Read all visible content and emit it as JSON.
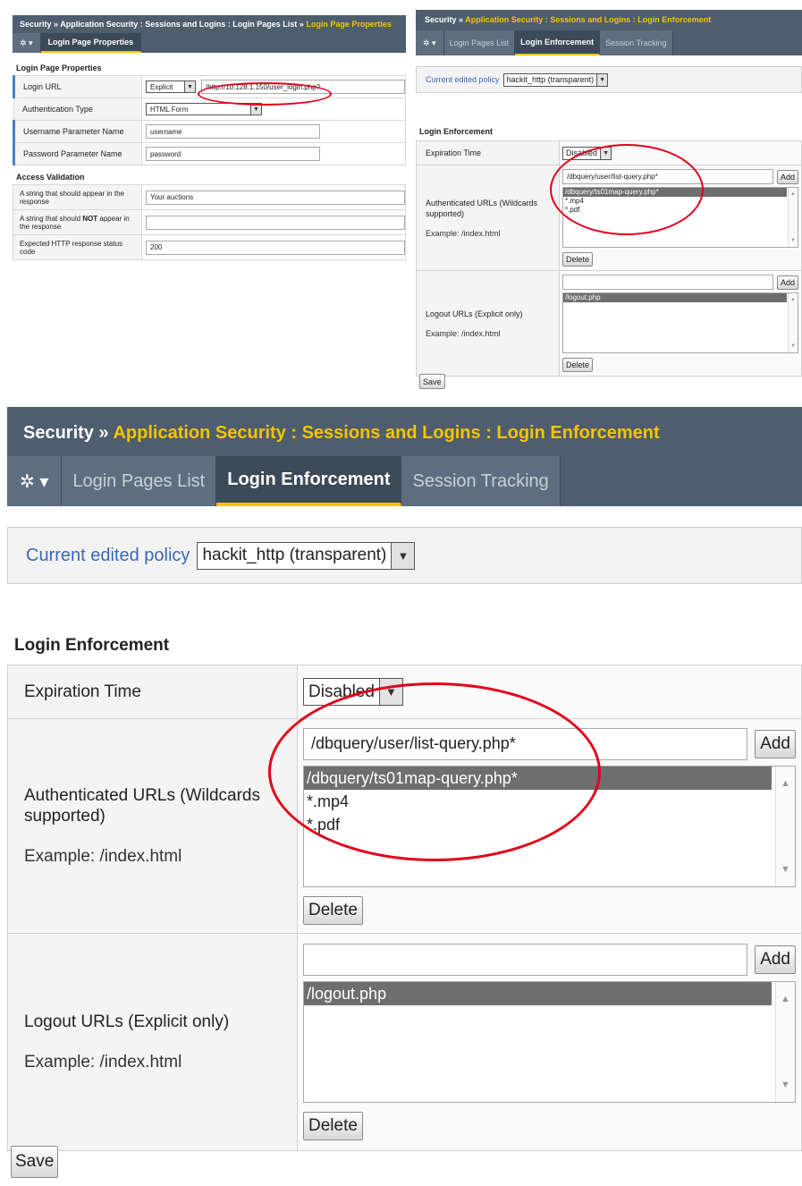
{
  "login_page_properties_panel": {
    "breadcrumb": {
      "root": "Security",
      "separator": "»",
      "path": "Application Security : Sessions and Logins : Login Pages List",
      "current": "Login Page Properties"
    },
    "tabs": {
      "gear_icon": "gear-icon",
      "active_tab": "Login Page Properties"
    },
    "section_title": "Login Page Properties",
    "fields": {
      "login_url_label": "Login URL",
      "login_url_type": "Explicit",
      "login_url_value": "/http://10.128.1.150/user_login.php?",
      "auth_type_label": "Authentication Type",
      "auth_type_value": "HTML Form",
      "username_param_label": "Username Parameter Name",
      "username_param_value": "username",
      "password_param_label": "Password Parameter Name",
      "password_param_value": "password"
    },
    "access_validation": {
      "title": "Access Validation",
      "should_appear_label": "A string that should appear in the response",
      "should_appear_value": "Your auctions",
      "should_not_appear_label_pre": "A string that should ",
      "should_not_appear_label_bold": "NOT",
      "should_not_appear_label_post": " appear in the response",
      "should_not_appear_value": "",
      "expected_code_label": "Expected HTTP response status code",
      "expected_code_value": "200"
    }
  },
  "login_enforcement": {
    "breadcrumb": {
      "root": "Security",
      "separator": "»",
      "path": "Application Security : Sessions and Logins : Login Enforcement"
    },
    "tabs": [
      {
        "label": "Login Pages List",
        "active": false
      },
      {
        "label": "Login Enforcement",
        "active": true
      },
      {
        "label": "Session Tracking",
        "active": false
      }
    ],
    "policy": {
      "label": "Current edited policy",
      "value": "hackit_http (transparent)"
    },
    "section_title": "Login Enforcement",
    "expiration": {
      "label": "Expiration Time",
      "value": "Disabled"
    },
    "authenticated_urls": {
      "label": "Authenticated URLs (Wildcards supported)",
      "example": "Example: /index.html",
      "input_value": "/dbquery/user/list-query.php*",
      "add_label": "Add",
      "items": [
        "/dbquery/ts01map-query.php*",
        "*.mp4",
        "*.pdf"
      ],
      "selected_index": 0,
      "delete_label": "Delete"
    },
    "logout_urls": {
      "label": "Logout URLs (Explicit only)",
      "example": "Example: /index.html",
      "input_value": "",
      "add_label": "Add",
      "items": [
        "/logout.php"
      ],
      "selected_index": 0,
      "delete_label": "Delete"
    },
    "save_label": "Save"
  },
  "icons": {
    "gear": "gear-icon",
    "dropdown_arrow": "chevron-down-icon",
    "scroll_up": "scroll-up-arrow-icon",
    "scroll_down": "scroll-down-arrow-icon"
  },
  "colors": {
    "header_bg": "#4e5e6e",
    "breadcrumb_highlight": "#f5c400",
    "active_tab_underline": "#f5c400",
    "policy_link": "#3a68b6",
    "annotation_ellipse": "#e3001b",
    "selected_item_bg": "#6e6e6e"
  }
}
